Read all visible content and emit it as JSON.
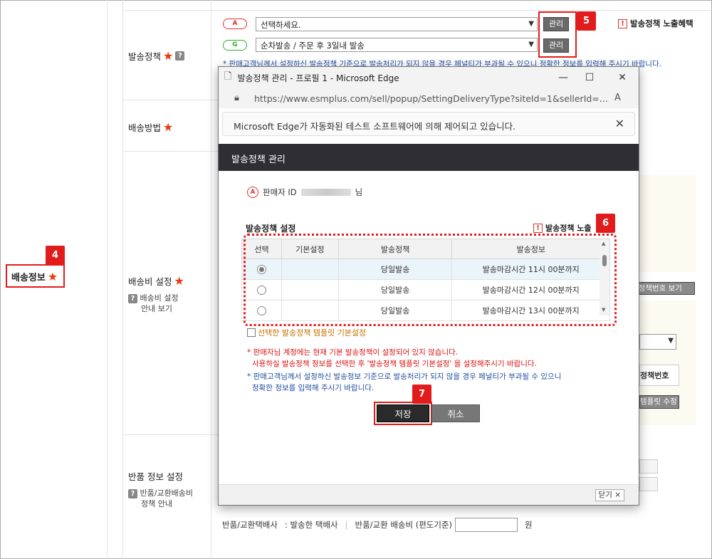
{
  "page": {
    "rows": {
      "policy": "발송정책",
      "method": "배송방법",
      "fee": "배송비 설정",
      "fee_guide": "배송비 설정",
      "fee_guide2": "안내 보기",
      "return": "반품 정보 설정",
      "return_guide": "반품/교환배송비",
      "return_guide2": "정책 안내"
    },
    "left_label": "배송정보",
    "policy_row": {
      "pill_a": "A",
      "pill_g": "G",
      "select_a": "선택하세요.",
      "select_g": "순차발송 / 주문 후 3일내 발송",
      "manage_a": "관리",
      "manage_g": "관리",
      "benefit": "발송정책 노출혜택",
      "notice": "* 판매고객님께서 설정하신 발송정책 기준으로 발송처리가 되지 않을 경우 페널티가 부과될 수 있으니 정확한 정보를 입력해 주시기 바랍니다."
    },
    "right_fragments": {
      "policy_no_view": "송정책번호 보기",
      "policy_no": "정책번호",
      "template_edit": "템플릿 수정"
    },
    "return_line": {
      "courier": "반품/교환택배사",
      "courier_value": ": 발송한 택배사",
      "fee_label": "반품/교환 배송비 (편도기준)",
      "unit": "원"
    }
  },
  "badges": {
    "b4": "4",
    "b5": "5",
    "b6": "6",
    "b7": "7"
  },
  "popup": {
    "window_title": "발송정책 관리 - 프로필 1 - Microsoft Edge",
    "url": "https://www.esmplus.com/sell/popup/SettingDeliveryType?siteId=1&sellerId=...",
    "infobar": "Microsoft Edge가 자동화된 테스트 소프트웨어에 의해 제어되고 있습니다.",
    "header": "발송정책 관리",
    "seller_prefix": "판매자 ID",
    "seller_suffix": "님",
    "section_title": "발송정책 설정",
    "exposure_link": "발송정책 노출",
    "table": {
      "headers": [
        "선택",
        "기본설정",
        "발송정책",
        "발송정보"
      ],
      "rows": [
        {
          "selected": true,
          "default": "",
          "policy": "당일발송",
          "info": "발송마감시간 11시 00분까지"
        },
        {
          "selected": false,
          "default": "",
          "policy": "당일발송",
          "info": "발송마감시간 12시 00분까지"
        },
        {
          "selected": false,
          "default": "",
          "policy": "당일발송",
          "info": "발송마감시간 13시 00분까지"
        }
      ]
    },
    "checkbox_label": "선택한 발송정책 템플릿 기본설정",
    "red_note_1": "* 판매자님 계정에는 현재 기본 발송정책이 설정되어 있지 않습니다.",
    "red_note_2": "사용하실 발송정책 정보를 선택한 후 '발송정책 템플릿 기본설정' 을 설정해주시기 바랍니다.",
    "blue_note_1": "* 판매고객님께서 설정하신 발송정보 기준으로 발송처리가 되지 않을 경우 페널티가 부과될 수 있으니",
    "blue_note_2": "정확한 정보를 입력해 주시기 바랍니다.",
    "save": "저장",
    "cancel": "취소",
    "close": "닫기 ×"
  },
  "colors": {
    "accent_red": "#e21c1c",
    "dark_header": "#2e2e33",
    "notice_blue": "#1f4fa0"
  }
}
